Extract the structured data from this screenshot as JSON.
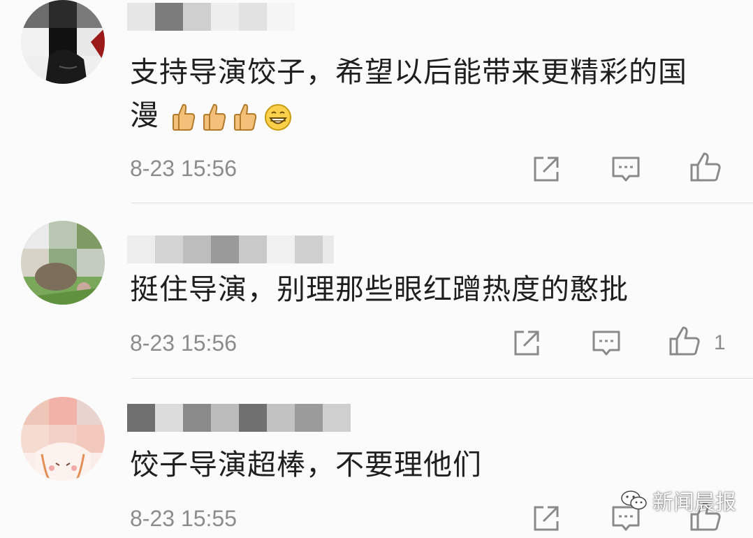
{
  "comments": [
    {
      "text_line1": "支持导演饺子，希望以后能带来更精彩的国",
      "text_line2": "漫",
      "emojis": [
        "thumbs-up-emoji",
        "thumbs-up-emoji",
        "thumbs-up-emoji",
        "grin-emoji"
      ],
      "time": "8-23 15:56",
      "like_count": ""
    },
    {
      "text_line1": "挺住导演，别理那些眼红蹭热度的憨批",
      "time": "8-23 15:56",
      "like_count": "1"
    },
    {
      "text_line1": "饺子导演超棒，不要理他们",
      "time": "8-23 15:55",
      "like_count": ""
    }
  ],
  "watermark": {
    "text": "新闻晨报"
  },
  "icons": {
    "share": "share-icon",
    "reply": "reply-icon",
    "like": "thumbs-up-icon"
  },
  "colors": {
    "text": "#1f1f1f",
    "meta": "#8c8c8c",
    "icon": "#8a8a8a",
    "background": "#fbfbfb"
  }
}
